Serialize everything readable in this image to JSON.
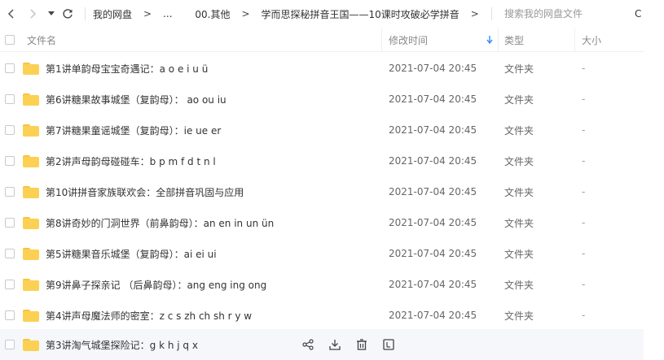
{
  "toolbar": {
    "breadcrumb": [
      "我的网盘",
      "...",
      "00.其他",
      "学而思探秘拼音王国——10课时攻破必学拼音"
    ],
    "search_placeholder": "搜索我的网盘文件",
    "refresh_icon": "refresh-icon",
    "dropdown_icon": "caret-down-icon"
  },
  "columns": {
    "name": "文件名",
    "modified": "修改时间",
    "type": "类型",
    "size": "大小",
    "sort_icon": "arrow-down-icon",
    "sort_color": "#2f8cf0"
  },
  "colors": {
    "folder": "#fcd153",
    "hover_row": "#f5f7fa"
  },
  "rows": [
    {
      "name": "第1讲单韵母宝宝奇遇记：a o e i u ü",
      "time": "2021-07-04 20:45",
      "type": "文件夹",
      "size": "-"
    },
    {
      "name": "第6讲糖果故事城堡（复韵母）： ao ou iu",
      "time": "2021-07-04 20:45",
      "type": "文件夹",
      "size": "-"
    },
    {
      "name": "第7讲糖果童谣城堡（复韵母）：ie ue er",
      "time": "2021-07-04 20:45",
      "type": "文件夹",
      "size": "-"
    },
    {
      "name": "第2讲声母韵母碰碰车：b p m f d t n l",
      "time": "2021-07-04 20:45",
      "type": "文件夹",
      "size": "-"
    },
    {
      "name": "第10讲拼音家族联欢会：全部拼音巩固与应用",
      "time": "2021-07-04 20:45",
      "type": "文件夹",
      "size": "-"
    },
    {
      "name": "第8讲奇妙的门洞世界（前鼻韵母）：an en in un ün",
      "time": "2021-07-04 20:45",
      "type": "文件夹",
      "size": "-"
    },
    {
      "name": "第5讲糖果音乐城堡（复韵母）：ai ei ui",
      "time": "2021-07-04 20:45",
      "type": "文件夹",
      "size": "-"
    },
    {
      "name": "第9讲鼻子探亲记 （后鼻韵母）：ang eng ing ong",
      "time": "2021-07-04 20:45",
      "type": "文件夹",
      "size": "-"
    },
    {
      "name": "第4讲声母魔法师的密室：z c s zh ch sh r y w",
      "time": "2021-07-04 20:45",
      "type": "文件夹",
      "size": "-"
    },
    {
      "name": "第3讲淘气城堡探险记：g k h j q x",
      "time": "",
      "type": "",
      "size": "",
      "hover_actions": [
        "share-icon",
        "download-icon",
        "delete-icon",
        "more-icon"
      ]
    }
  ]
}
